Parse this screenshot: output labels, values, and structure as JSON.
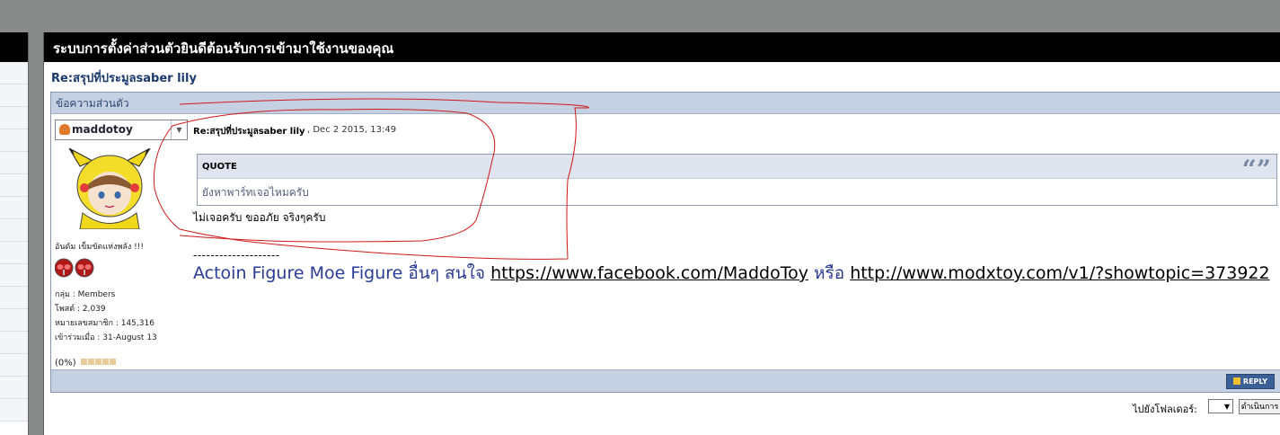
{
  "window": {
    "title": "ระบบการตั้งค่าส่วนตัวยินดีต้อนรับการเข้ามาใช้งานของคุณ"
  },
  "topic": {
    "title": "Re:สรุปที่ประมูลsaber lily"
  },
  "panel": {
    "header": "ข้อความส่วนตัว"
  },
  "author": {
    "name": "maddotoy",
    "rank_title": "อันดัม เข็มขัดแห่งพลัง !!!",
    "group_label": "กลุ่ม : Members",
    "posts_label": "โพสต์ : 2,039",
    "member_no_label": "หมายเลขสมาชิก : 145,316",
    "joined_label": "เข้าร่วมเมื่อ : 31-August 13",
    "warn_level": "(0%)",
    "icons": [
      "avatar-icon",
      "rider-mask-icon",
      "rider-mask-icon"
    ]
  },
  "post": {
    "title": "Re:สรุปที่ประมูลsaber lily",
    "date": ", Dec 2 2015, 13:49",
    "quote_label": "QUOTE",
    "quote_icon": "quote-marks-icon",
    "quote_text": "ยังหาพาร์ทเจอไหมครับ",
    "reply_text": "ไม่เจอครับ ขออภัย จริงๆครับ",
    "signature_separator": "--------------------",
    "signature_lead": "Actoin Figure Moe Figure อื่นๆ สนใจ",
    "signature_link1": "https://www.facebook.com/MaddoToy",
    "signature_or": "หรือ",
    "signature_link2": "http://www.modxtoy.com/v1/?showtopic=373922"
  },
  "footer": {
    "reply_button": "REPLY",
    "jump_label": "ไปยังโฟลเดอร์:",
    "jump_button": "ดำเนินการ"
  },
  "colors": {
    "title_bar": "#000000",
    "panel_header": "#c6d0e3",
    "annotation_stroke": "#d01818"
  }
}
